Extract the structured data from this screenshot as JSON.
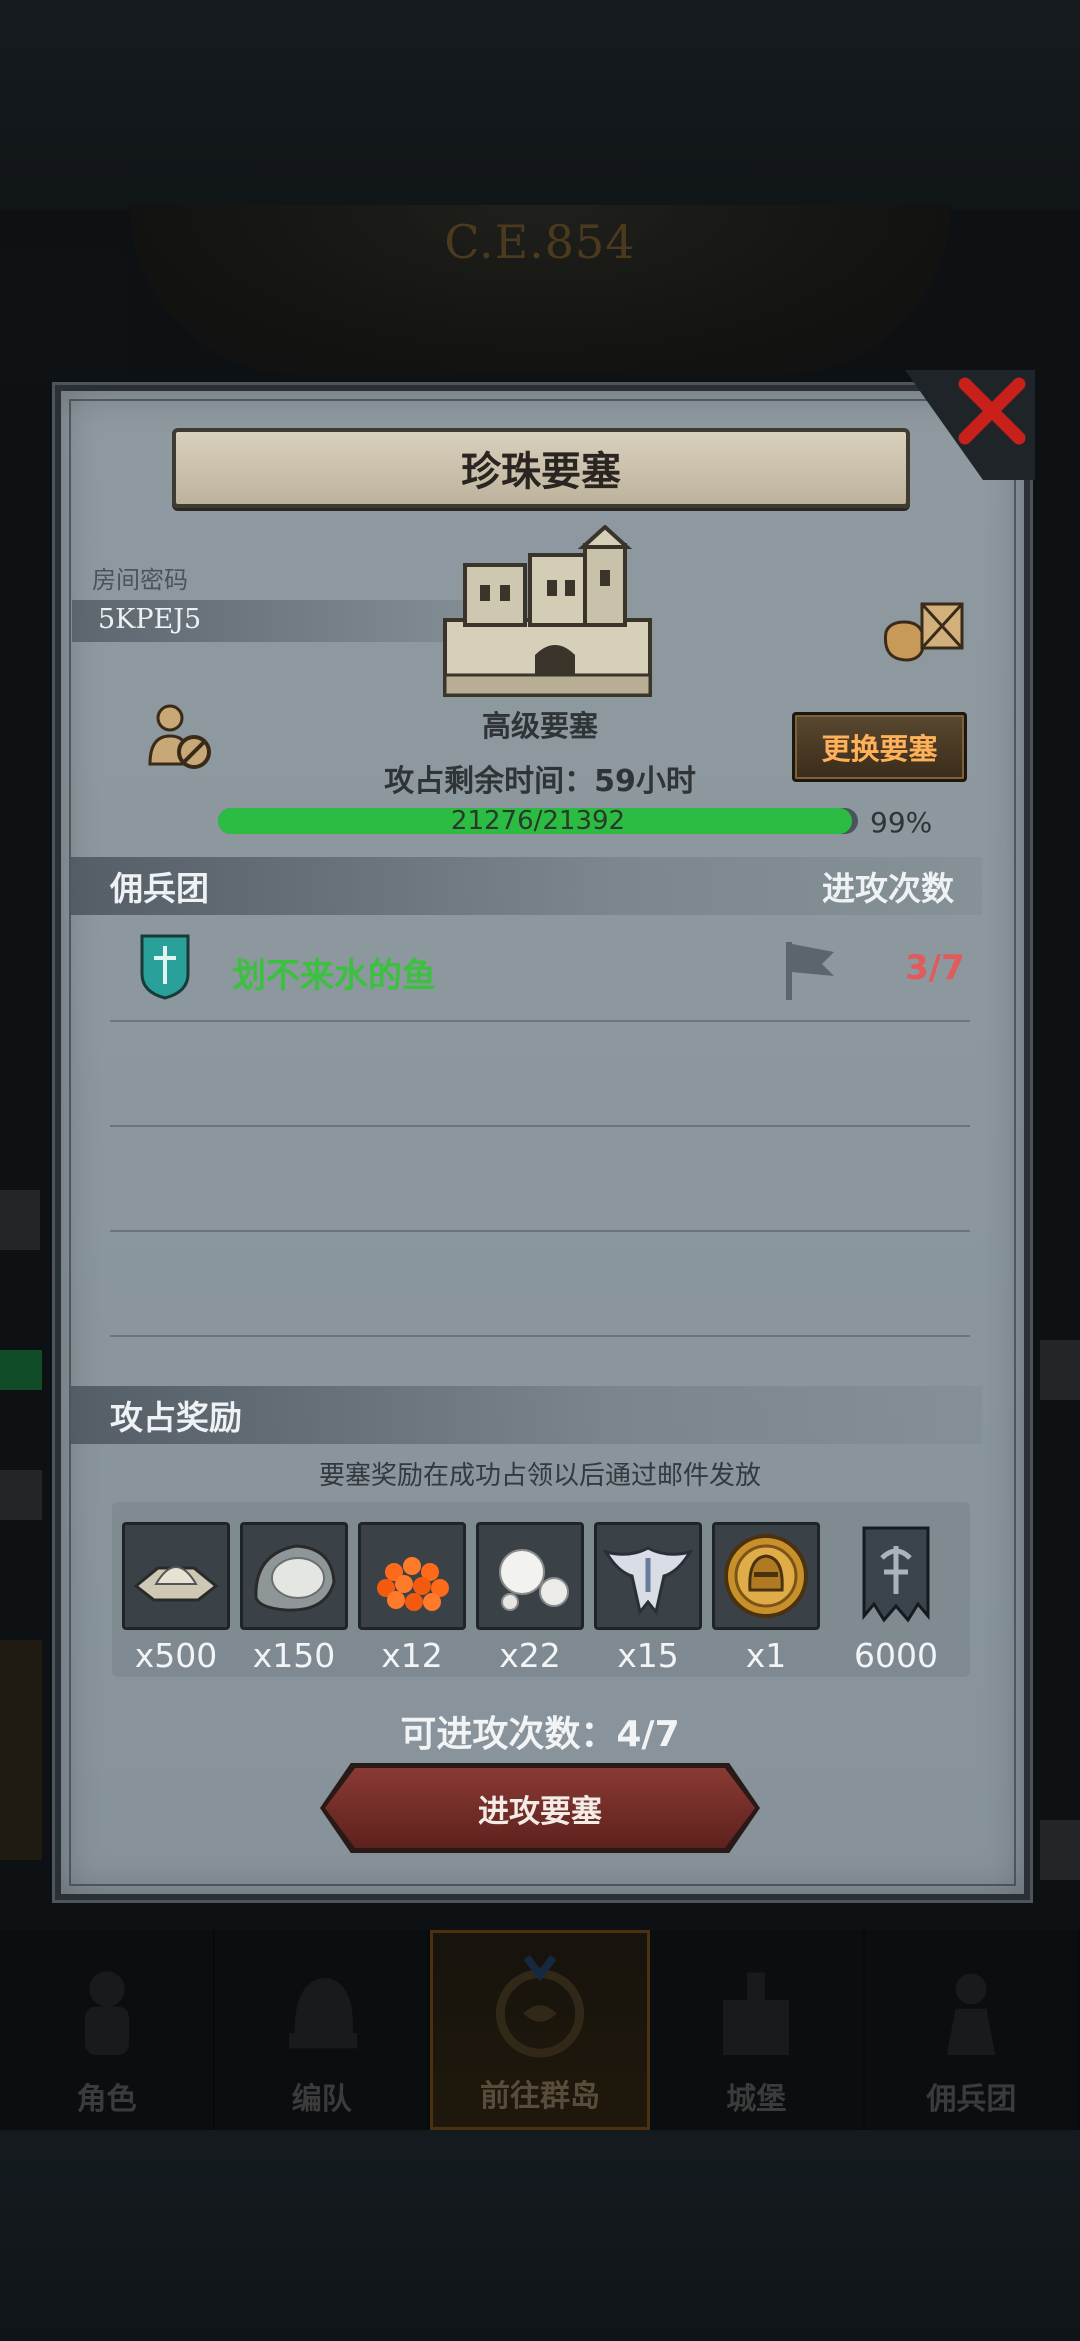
{
  "header": {
    "era": "C.E.854"
  },
  "dialog": {
    "title": "珍珠要塞",
    "room_password_label": "房间密码",
    "room_password": "5KPEJ5",
    "fortress_level": "高级要塞",
    "change_fortress_label": "更换要塞",
    "time_left_text": "攻占剩余时间：59小时",
    "hp": {
      "current": 21276,
      "max": 21392,
      "text": "21276/21392",
      "percent_text": "99%",
      "fraction": 0.99
    },
    "mercenary_section": {
      "title": "佣兵团",
      "attacks_header": "进攻次数"
    },
    "guilds": [
      {
        "name": "划不来水的鱼",
        "attacks": "3/7"
      }
    ],
    "reward_section": {
      "title": "攻占奖励",
      "note": "要塞奖励在成功占领以后通过邮件发放"
    },
    "rewards": [
      {
        "icon": "salt-icon",
        "qty": "x500"
      },
      {
        "icon": "oyster-icon",
        "qty": "x150"
      },
      {
        "icon": "fish-roe-icon",
        "qty": "x12"
      },
      {
        "icon": "pearls-icon",
        "qty": "x22"
      },
      {
        "icon": "silver-emblem-icon",
        "qty": "x15"
      },
      {
        "icon": "gold-helmet-coin-icon",
        "qty": "x1"
      },
      {
        "icon": "banner-icon",
        "qty": "6000"
      }
    ],
    "attacks_remaining_text": "可进攻次数：4/7",
    "attack_button_label": "进攻要塞"
  },
  "bottom_nav": {
    "items": [
      {
        "label": "角色"
      },
      {
        "label": "编队"
      },
      {
        "label": "前往群岛"
      },
      {
        "label": "城堡"
      },
      {
        "label": "佣兵团"
      }
    ],
    "active_index": 2
  },
  "colors": {
    "guild_name": "#3cc040",
    "attack_count": "#e25a5a",
    "change_button_text": "#ffb15a",
    "hp_fill": "#2cbc44"
  }
}
